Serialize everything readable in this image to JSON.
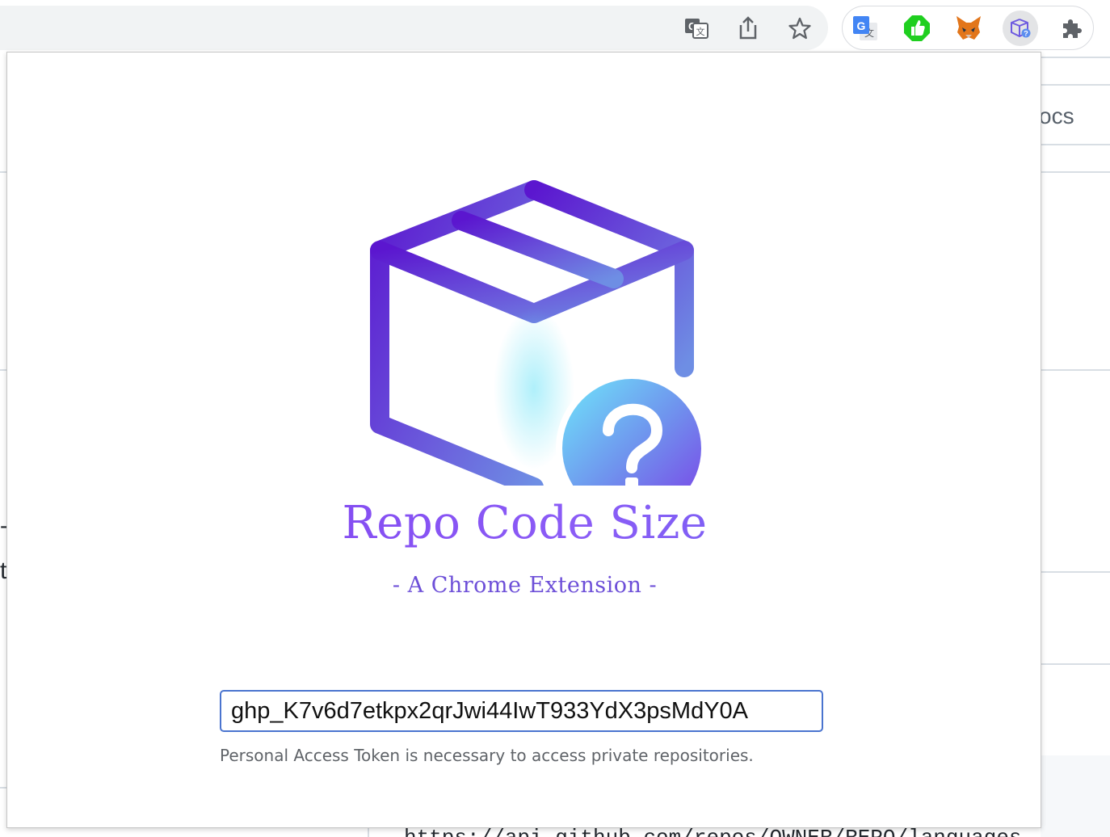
{
  "background_page": {
    "tab_fragment": "ocs",
    "left_fragment_1": "-",
    "left_fragment_2": "t",
    "code_fragment": "https://api.github.com/repos/OWNER/REPO/languages"
  },
  "toolbar": {
    "icons": [
      "translate-icon",
      "share-icon",
      "bookmark-star-icon"
    ],
    "extensions": [
      "google-translate-icon",
      "green-thumb-icon",
      "metamask-fox-icon",
      "repo-code-size-icon",
      "extensions-puzzle-icon"
    ]
  },
  "popup": {
    "title": "Repo Code Size",
    "subtitle": "- A Chrome Extension -",
    "token_value": "ghp_K7v6d7etkpx2qrJwi44IwT933YdX3psMdY0A",
    "hint": "Personal Access Token is necessary to access private repositories."
  },
  "colors": {
    "accent_purple": "#6d28d9",
    "accent_cyan": "#67e0f5",
    "input_border": "#4a74cf"
  }
}
